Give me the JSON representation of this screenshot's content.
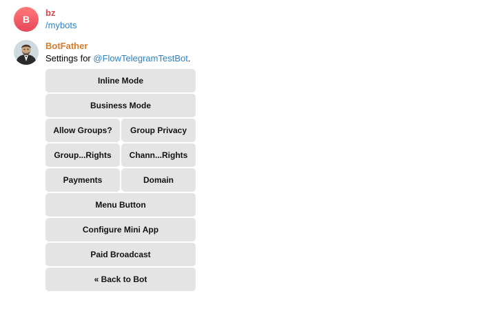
{
  "messages": [
    {
      "sender": "bz",
      "avatar_letter": "B",
      "text": "/mybots"
    },
    {
      "sender": "BotFather",
      "text_prefix": "Settings for ",
      "mention": "@FlowTelegramTestBot",
      "text_suffix": "."
    }
  ],
  "colors": {
    "bz_name": "#e0434c",
    "botfather_name": "#d87b2e",
    "link": "#2a7fc9",
    "button_bg": "#e4e4e4"
  },
  "keyboard": {
    "rows": [
      [
        "Inline Mode"
      ],
      [
        "Business Mode"
      ],
      [
        "Allow Groups?",
        "Group Privacy"
      ],
      [
        "Group...Rights",
        "Chann...Rights"
      ],
      [
        "Payments",
        "Domain"
      ],
      [
        "Menu Button"
      ],
      [
        "Configure Mini App"
      ],
      [
        "Paid Broadcast"
      ],
      [
        "« Back to Bot"
      ]
    ]
  }
}
